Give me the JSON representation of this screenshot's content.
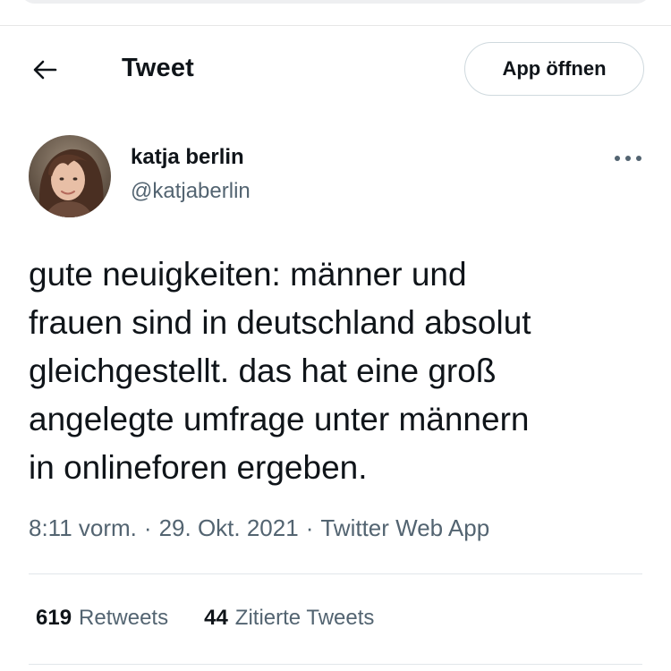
{
  "header": {
    "title": "Tweet",
    "open_app_label": "App öffnen"
  },
  "author": {
    "display_name": "katja berlin",
    "handle": "@katjaberlin"
  },
  "tweet": {
    "text": "gute neuigkeiten: männer und\nfrauen sind in deutschland absolut\ngleichgestellt. das hat eine groß\nangelegte umfrage unter männern\nin onlineforen ergeben.",
    "time": "8:11 vorm.",
    "date": "29. Okt. 2021",
    "source": "Twitter Web App",
    "separator": "·"
  },
  "stats": {
    "retweets_count": "619",
    "retweets_label": "Retweets",
    "quotes_count": "44",
    "quotes_label": "Zitierte Tweets"
  },
  "icons": {
    "back": "arrow-left-icon",
    "more": "more-horizontal-icon",
    "avatar": "profile-photo"
  },
  "colors": {
    "text_primary": "#0f1419",
    "text_secondary": "#536471",
    "border": "#cfd9de"
  }
}
